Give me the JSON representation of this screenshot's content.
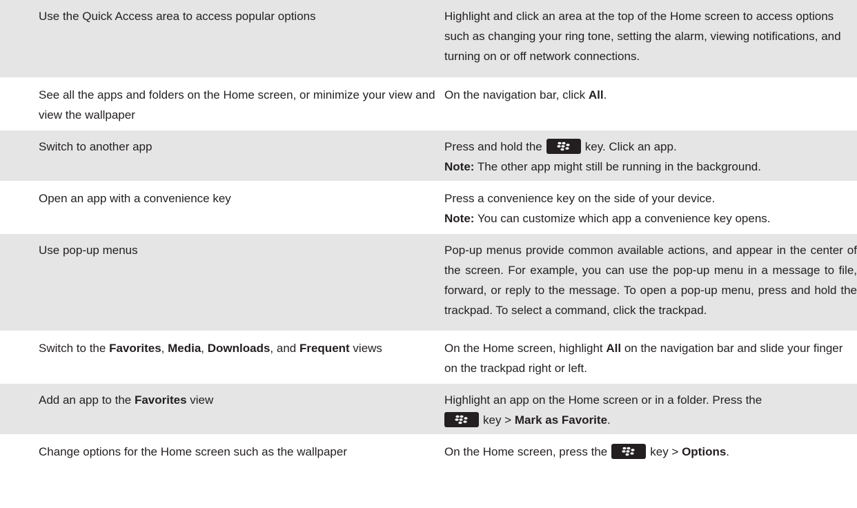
{
  "rows": [
    {
      "task": "Use the Quick Access area to access popular options",
      "desc": "Highlight and click an area at the top of the Home screen to access options such as changing your ring tone, setting the alarm, viewing notifications, and turning on or off network connections."
    },
    {
      "task": "See all the apps and folders on the Home screen, or minimize your view and view the wallpaper",
      "desc_pre": "On the navigation bar, click ",
      "desc_bold": "All",
      "desc_post": "."
    },
    {
      "task": "Switch to another app",
      "desc_pre": "Press and hold the",
      "desc_post": "key. Click an app.",
      "note_label": "Note:",
      "note_text": " The other app might still be running in the background."
    },
    {
      "task": "Open an app with a convenience key",
      "desc": "Press a convenience key on the side of your device.",
      "note_label": "Note:",
      "note_text": " You can customize which app a convenience key opens."
    },
    {
      "task": "Use pop-up menus",
      "desc": "Pop-up menus provide common available actions, and appear in the center of the screen. For example, you can use the pop-up menu in a message to file, forward, or reply to the message. To open a pop-up menu, press and hold the trackpad. To select a command, click the trackpad."
    },
    {
      "task_1": "Switch to the ",
      "task_b1": "Favorites",
      "task_2": ", ",
      "task_b2": "Media",
      "task_3": ", ",
      "task_b3": "Downloads",
      "task_4": ", and ",
      "task_b4": "Frequent",
      "task_5": " views",
      "desc_pre": "On the Home screen, highlight ",
      "desc_bold": "All",
      "desc_post": " on the navigation bar and slide your finger on the trackpad right or left."
    },
    {
      "task_1": "Add an app to the ",
      "task_b1": "Favorites",
      "task_2": " view",
      "desc_pre": "Highlight an app on the Home screen or in a folder. Press the",
      "desc_mid": "key > ",
      "desc_bold": "Mark as Favorite",
      "desc_post": "."
    },
    {
      "task": "Change options for the Home screen such as the wallpaper",
      "desc_pre": "On the Home screen, press the",
      "desc_mid": "key > ",
      "desc_bold": "Options",
      "desc_post": "."
    }
  ],
  "icons": {
    "menu_key": "blackberry-menu-key-icon"
  },
  "colors": {
    "row_shade": "#e5e5e5",
    "key_bg": "#231f20"
  }
}
